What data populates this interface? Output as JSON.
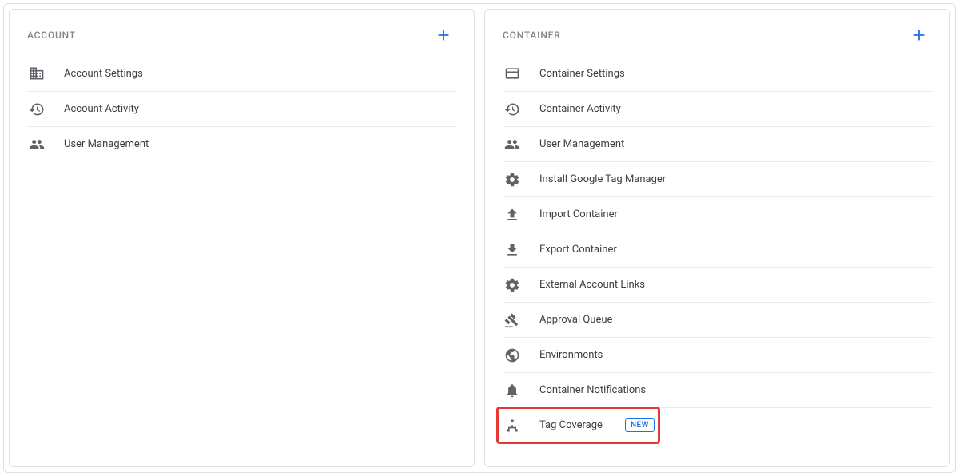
{
  "colors": {
    "plus": "#1a73e8",
    "icon": "#5f6368",
    "highlight": "#e53935"
  },
  "account": {
    "title": "ACCOUNT",
    "items": [
      {
        "icon": "domain-icon",
        "label": "Account Settings"
      },
      {
        "icon": "history-icon",
        "label": "Account Activity"
      },
      {
        "icon": "people-icon",
        "label": "User Management"
      }
    ]
  },
  "container": {
    "title": "CONTAINER",
    "items": [
      {
        "icon": "web-icon",
        "label": "Container Settings"
      },
      {
        "icon": "history-icon",
        "label": "Container Activity"
      },
      {
        "icon": "people-icon",
        "label": "User Management"
      },
      {
        "icon": "gear-icon",
        "label": "Install Google Tag Manager"
      },
      {
        "icon": "upload-icon",
        "label": "Import Container"
      },
      {
        "icon": "download-icon",
        "label": "Export Container"
      },
      {
        "icon": "gear-icon",
        "label": "External Account Links"
      },
      {
        "icon": "gavel-icon",
        "label": "Approval Queue"
      },
      {
        "icon": "globe-icon",
        "label": "Environments"
      },
      {
        "icon": "bell-icon",
        "label": "Container Notifications"
      },
      {
        "icon": "sitemap-icon",
        "label": "Tag Coverage",
        "badge": "NEW",
        "highlight": true
      }
    ]
  }
}
